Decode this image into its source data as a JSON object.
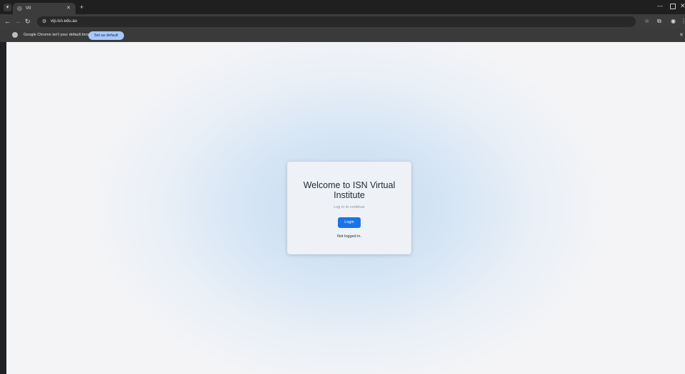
{
  "browser": {
    "tab": {
      "title": "VII"
    },
    "url": "vip.isn.edu.au",
    "infobar": {
      "message": "Google Chrome isn't your default browser",
      "action_label": "Set as default"
    }
  },
  "page": {
    "title": "Welcome to ISN Virtual Institute",
    "subtitle": "Log in to continue",
    "login_label": "Login",
    "status": "Not logged in."
  },
  "icons": {
    "tab_search": "tab-search-icon",
    "favicon": "site-favicon-icon",
    "close": "close-icon",
    "new_tab": "plus-icon",
    "back": "back-arrow-icon",
    "forward": "forward-arrow-icon",
    "reload": "reload-icon",
    "site_info": "site-info-icon",
    "bookmark": "star-icon",
    "extensions": "puzzle-icon",
    "profile": "profile-icon",
    "menu": "kebab-menu-icon"
  },
  "colors": {
    "accent": "#1a73e8",
    "infobar_button": "#a8c7fa"
  }
}
